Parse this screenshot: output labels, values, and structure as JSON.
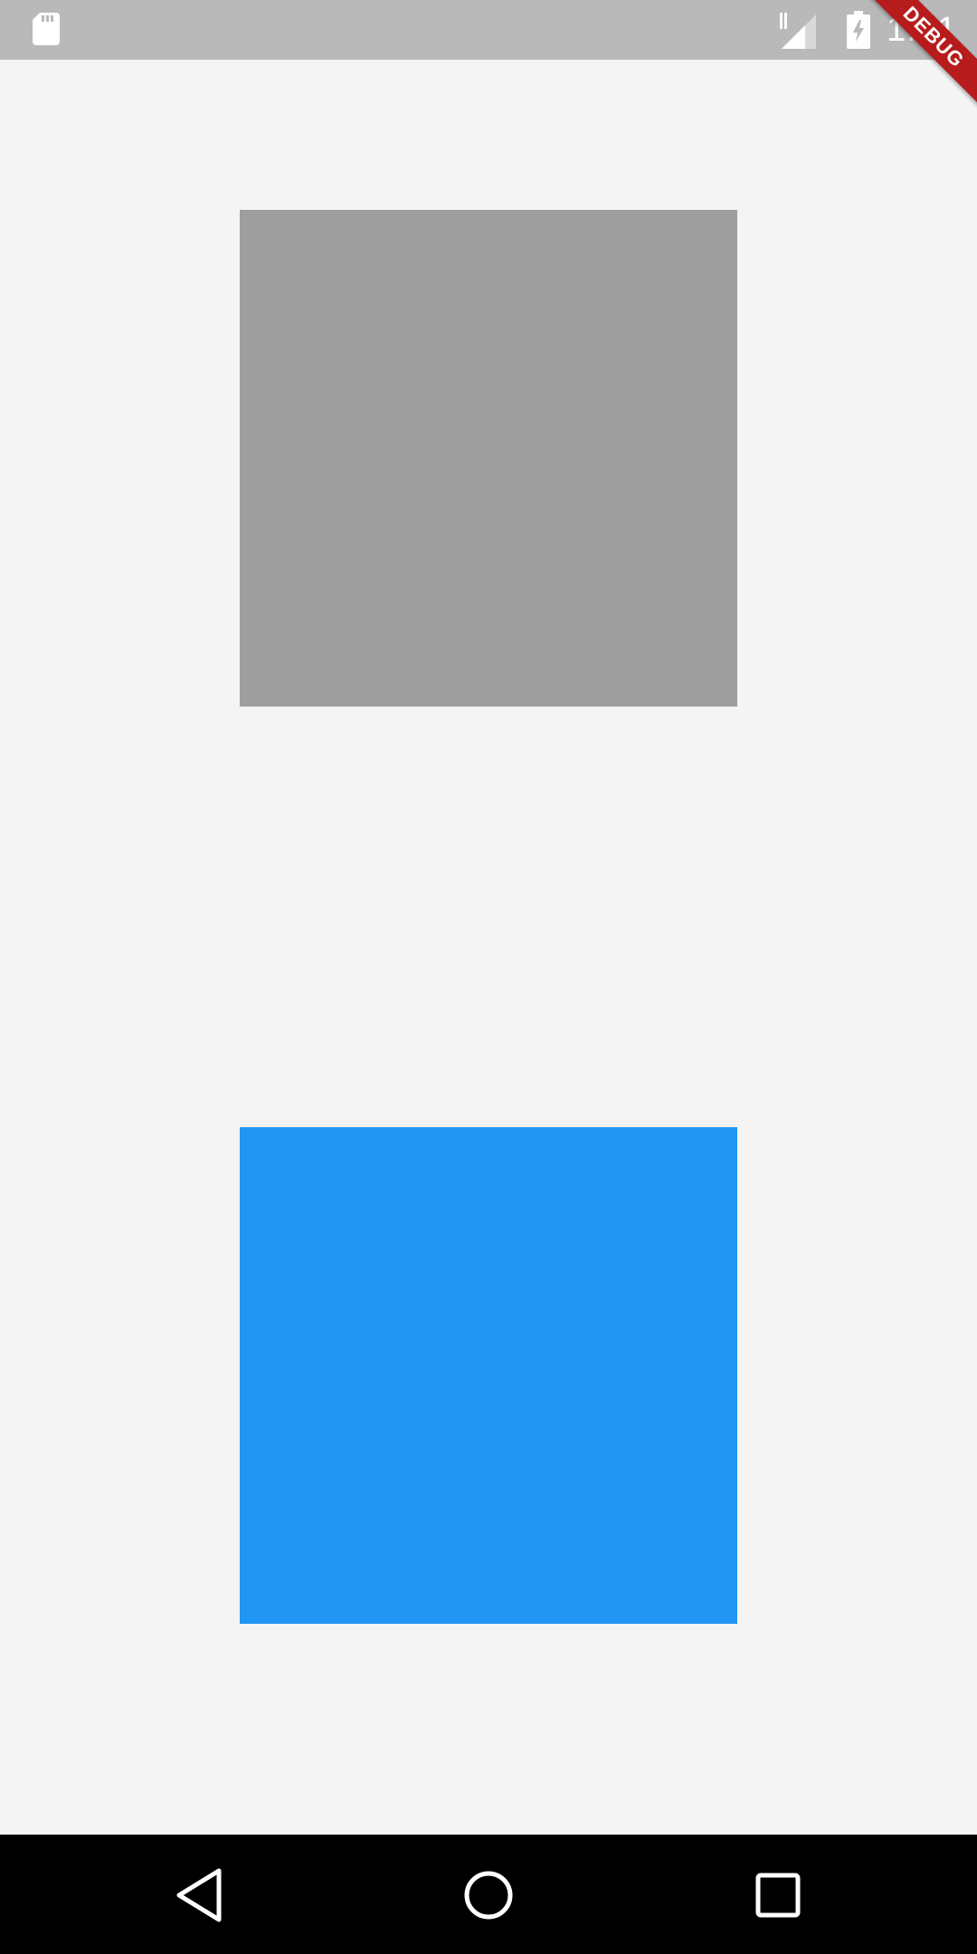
{
  "status_bar": {
    "time": "1:21",
    "background_color": "#b9b9b9",
    "icons": [
      "sd-card-icon",
      "signal-icon",
      "battery-charging-icon"
    ]
  },
  "debug_banner": {
    "label": "DEBUG",
    "color": "#b71c1c"
  },
  "content": {
    "background_color": "#f4f4f4",
    "boxes": [
      {
        "name": "grey-box",
        "color": "#9e9e9e"
      },
      {
        "name": "blue-box",
        "color": "#2196f3"
      }
    ]
  },
  "navigation_bar": {
    "buttons": [
      "back-icon",
      "home-icon",
      "recents-icon"
    ],
    "background_color": "#000000"
  }
}
